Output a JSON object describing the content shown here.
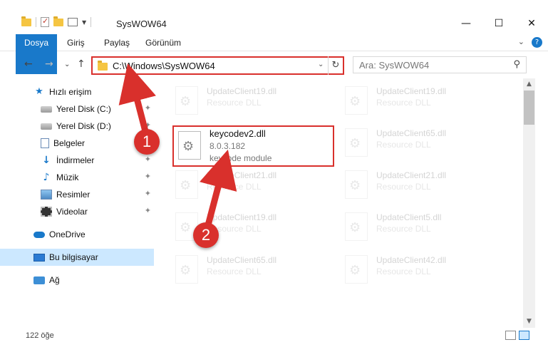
{
  "window": {
    "title": "SysWOW64",
    "controls": {
      "minimize": "—",
      "maximize": "☐",
      "close": "✕"
    }
  },
  "ribbon": {
    "tabs": [
      {
        "label": "Dosya",
        "active": true
      },
      {
        "label": "Giriş"
      },
      {
        "label": "Paylaş"
      },
      {
        "label": "Görünüm"
      }
    ],
    "expand_glyph": "⌄",
    "help_glyph": "?"
  },
  "nav": {
    "back": "←",
    "forward": "→",
    "recent": "⌄",
    "up": "↑"
  },
  "address": {
    "path": "C:\\Windows\\SysWOW64",
    "dropdown": "⌄",
    "refresh": "↻"
  },
  "search": {
    "placeholder": "Ara: SysWOW64",
    "icon": "⚲"
  },
  "sidebar": {
    "items": [
      {
        "label": "Hızlı erişim",
        "icon": "star-icon"
      },
      {
        "label": "Yerel Disk (C:)",
        "icon": "drive-icon",
        "pinned": true
      },
      {
        "label": "Yerel Disk (D:)",
        "icon": "drive-icon",
        "pinned": true
      },
      {
        "label": "Belgeler",
        "icon": "documents-icon",
        "pinned": true
      },
      {
        "label": "İndirmeler",
        "icon": "downloads-icon",
        "pinned": true
      },
      {
        "label": "Müzik",
        "icon": "music-icon",
        "pinned": true
      },
      {
        "label": "Resimler",
        "icon": "pictures-icon",
        "pinned": true
      },
      {
        "label": "Videolar",
        "icon": "videos-icon",
        "pinned": true
      },
      {
        "label": "OneDrive",
        "icon": "onedrive-icon"
      },
      {
        "label": "Bu bilgisayar",
        "icon": "this-pc-icon",
        "selected": true
      },
      {
        "label": "Ağ",
        "icon": "network-icon"
      }
    ],
    "pin_glyph": "📌"
  },
  "files": {
    "highlighted": {
      "name": "keycodev2.dll",
      "version": "8.0.3.182",
      "description": "keycode module"
    },
    "background": [
      {
        "name": "UpdateClient19.dll",
        "type": "Resource DLL"
      },
      {
        "name": "UpdateClient19.dll",
        "type": "Resource DLL"
      },
      {
        "name": "UpdateClient65.dll",
        "type": "Resource DLL"
      },
      {
        "name": "UpdateClient21.dll",
        "type": "Resource DLL"
      },
      {
        "name": "UpdateClient21.dll",
        "type": "Resource DLL"
      },
      {
        "name": "UpdateClient19.dll",
        "type": "Resource DLL"
      },
      {
        "name": "UpdateClient5.dll",
        "type": "Resource DLL"
      },
      {
        "name": "UpdateClient65.dll",
        "type": "Resource DLL"
      },
      {
        "name": "UpdateClient42.dll",
        "type": "Resource DLL"
      }
    ]
  },
  "status": {
    "item_count": "122 öğe"
  },
  "callouts": {
    "one": "1",
    "two": "2"
  },
  "colors": {
    "accent": "#1979ca",
    "highlight": "#d9302c",
    "selected_bg": "#cce8ff"
  }
}
